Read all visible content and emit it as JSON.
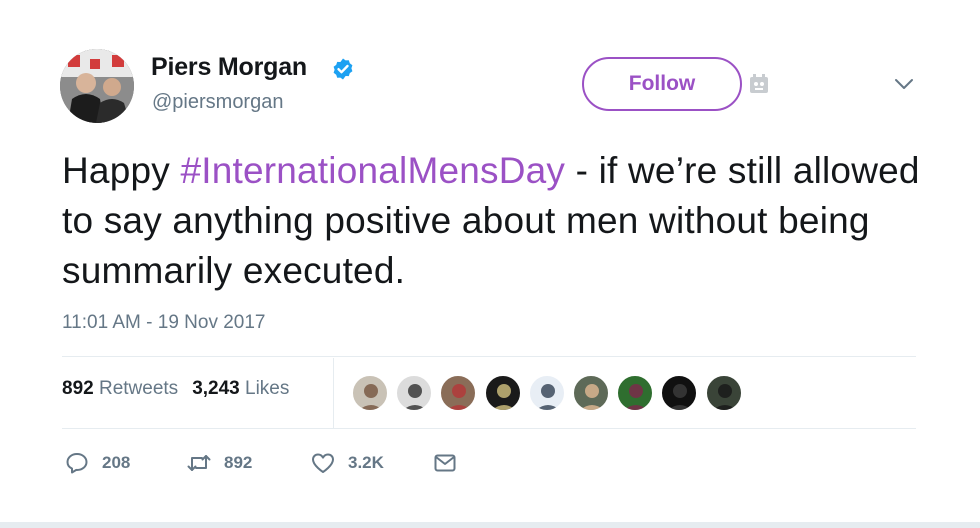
{
  "user": {
    "name": "Piers Morgan",
    "handle": "@piersmorgan",
    "verified_color": "#1da1f2",
    "avatar_icon": "user-photo"
  },
  "follow_label": "Follow",
  "tweet": {
    "text_before": "Happy ",
    "hashtag": "#InternationalMensDay",
    "text_after": " - if we’re still allowed to say anything positive about men without being summarily executed."
  },
  "timestamp": "11:01 AM - 19 Nov 2017",
  "stats": {
    "retweets_count": "892",
    "retweets_label": "Retweets",
    "likes_count": "3,243",
    "likes_label": "Likes"
  },
  "likers": [
    {
      "bg": "#c9c2b6",
      "fg": "#7a5a45"
    },
    {
      "bg": "#dcdcdc",
      "fg": "#3a3a3a"
    },
    {
      "bg": "#8a6d58",
      "fg": "#b23a3a"
    },
    {
      "bg": "#1a1a1a",
      "fg": "#c9b87a"
    },
    {
      "bg": "#e8eef5",
      "fg": "#3c4a5c"
    },
    {
      "bg": "#5e6a58",
      "fg": "#d9b48f"
    },
    {
      "bg": "#2f6e2f",
      "fg": "#7a2c4a"
    },
    {
      "bg": "#101010",
      "fg": "#3a3a3a"
    },
    {
      "bg": "#3a4438",
      "fg": "#1a1a1a"
    }
  ],
  "actions": {
    "replies": "208",
    "retweets": "892",
    "likes": "3.2K"
  },
  "accent_color": "#9b51c5"
}
